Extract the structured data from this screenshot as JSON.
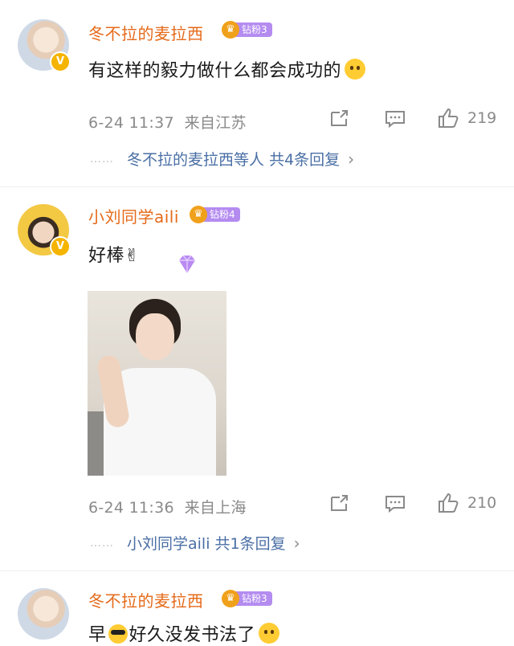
{
  "comments": [
    {
      "username": "冬不拉的麦拉西",
      "badge": "钻粉3",
      "text": "有这样的毅力做什么都会成功的",
      "time": "6-24 11:37",
      "location": "来自江苏",
      "likes": "219",
      "replies_text": "冬不拉的麦拉西等人",
      "replies_count": "共4条回复"
    },
    {
      "username": "小刘同学aili",
      "badge": "钻粉4",
      "text": "好棒✌",
      "time": "6-24 11:36",
      "location": "来自上海",
      "likes": "210",
      "replies_text": "小刘同学aili",
      "replies_count": "共1条回复"
    },
    {
      "username": "冬不拉的麦拉西",
      "badge": "钻粉3",
      "text_a": "早",
      "text_b": "好久没发书法了"
    }
  ],
  "icons": {
    "verified": "v-badge-icon",
    "share": "share-icon",
    "comment": "comment-icon",
    "like": "thumbs-up-icon",
    "chevron": "chevron-right-icon"
  },
  "colors": {
    "username": "#e56a1a",
    "reply_link": "#4a6fa5",
    "meta": "#8a8a8a",
    "badge": "#b48cf0"
  }
}
